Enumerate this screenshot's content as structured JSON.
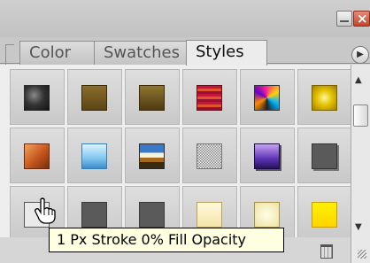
{
  "window": {
    "minimize_icon": "minimize-icon",
    "close_icon": "close-icon",
    "close_glyph": "×"
  },
  "tabs": [
    {
      "label": "Color",
      "active": false
    },
    {
      "label": "Swatches",
      "active": false
    },
    {
      "label": "Styles",
      "active": true
    }
  ],
  "panel_menu_icon": "flyout-menu-icon",
  "styles": [
    [
      "smoke",
      "brown",
      "brown2",
      "stripes",
      "chaos",
      "gold"
    ],
    [
      "sunset",
      "blue",
      "landscape",
      "noise",
      "purple",
      "darkgray"
    ],
    [
      "stroke",
      "gray",
      "gray",
      "cream",
      "cream2",
      "yellow"
    ]
  ],
  "tooltip": {
    "text": "1 Px Stroke 0% Fill Opacity"
  },
  "scrollbar": {
    "up_glyph": "▲",
    "down_glyph": "▼"
  },
  "colors": {
    "accent": "#ffffe1",
    "close": "#c2452b"
  }
}
